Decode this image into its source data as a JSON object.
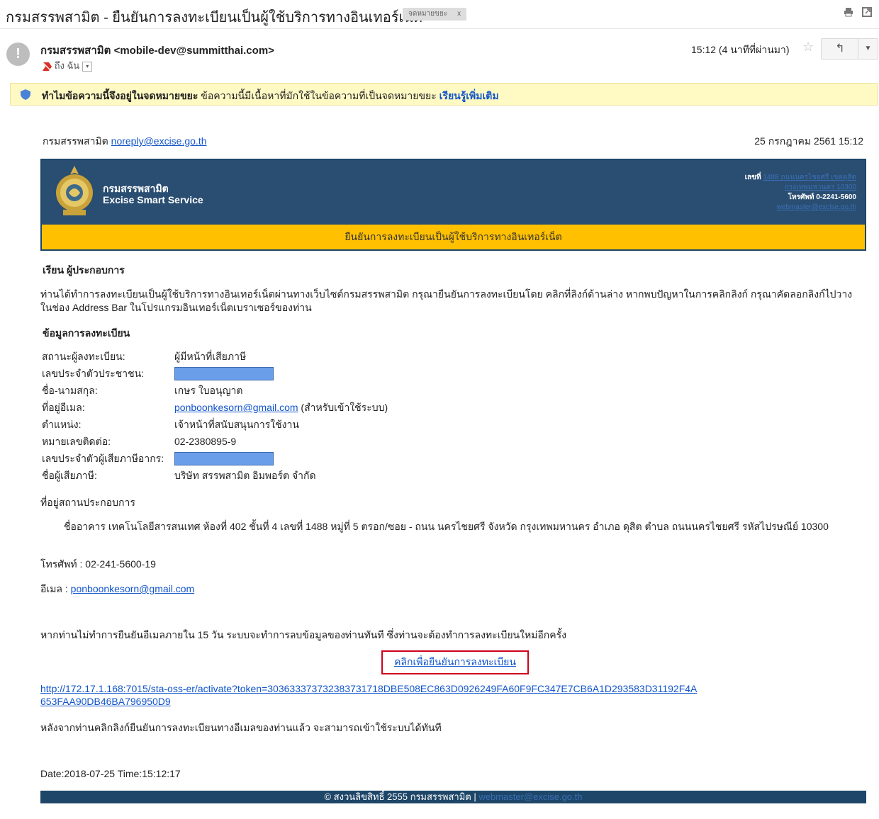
{
  "header": {
    "subject": "กรมสรรพสามิต - ยืนยันการลงทะเบียนเป็นผู้ใช้บริการทางอินเทอร์เน็ต",
    "label": "จดหมายขยะ",
    "label_close": "x"
  },
  "sender": {
    "avatar_glyph": "!",
    "name": "กรมสรรพสามิต",
    "email": "<mobile-dev@summitthai.com>",
    "to": "ถึง ฉัน",
    "timestamp": "15:12 (4 นาทีที่ผ่านมา)"
  },
  "spam_banner": {
    "bold": "ทำไมข้อความนี้จึงอยู่ในจดหมายขยะ",
    "text": "ข้อความนี้มีเนื้อหาที่มักใช้ในข้อความที่เป็นจดหมายขยะ",
    "link": "เรียนรู้เพิ่มเติม"
  },
  "email": {
    "from_name": "กรมสรรพสามิต",
    "from_email": "noreply@excise.go.th",
    "date": "25 กรกฎาคม 2561 15:12",
    "org_th": "กรมสรรพสามิต",
    "org_en": "Excise Smart Service",
    "contact_label": "เลขที่",
    "contact_addr": "1488 ถนนนครไชยศรี เขตดุสิต",
    "contact_addr2": "กรุงเทพมหานคร 10300",
    "contact_phone": "โทรศัพท์ 0-2241-5600",
    "contact_web": "webmaster@excise.go.th",
    "band_title": "ยืนยันการลงทะเบียนเป็นผู้ใช้บริการทางอินเทอร์เน็ต",
    "greeting": "เรียน ผู้ประกอบการ",
    "intro": "ท่านได้ทำการลงทะเบียนเป็นผู้ใช้บริการทางอินเทอร์เน็ตผ่านทางเว็บไซต์กรมสรรพสามิต กรุณายืนยันการลงทะเบียนโดย คลิกที่ลิงก์ด้านล่าง หากพบปัญหาในการคลิกลิงก์ กรุณาคัดลอกลิงก์ไปวางในช่อง Address Bar ในโปรแกรมอินเทอร์เน็ตเบราเซอร์ของท่าน",
    "reg_title": "ข้อมูลการลงทะเบียน",
    "reg": {
      "status_k": "สถานะผู้ลงทะเบียน:",
      "status_v": "ผู้มีหน้าที่เสียภาษี",
      "id_k": "เลขประจำตัวประชาชน:",
      "name_k": "ชื่อ-นามสกุล:",
      "name_v": "เกษร ใบอนุญาต",
      "email_k": "ที่อยู่อีเมล:",
      "email_v": "ponboonkesorn@gmail.com",
      "email_note": "(สำหรับเข้าใช้ระบบ)",
      "pos_k": "ตำแหน่ง:",
      "pos_v": "เจ้าหน้าที่สนับสนุนการใช้งาน",
      "phone_k": "หมายเลขติดต่อ:",
      "phone_v": "02-2380895-9",
      "taxid_k": "เลขประจำตัวผู้เสียภาษีอากร:",
      "taxpayer_k": "ชื่อผู้เสียภาษี:",
      "taxpayer_v": "บริษัท สรรพสามิต อิมพอร์ต จำกัด"
    },
    "addr_heading": "ที่อยู่สถานประกอบการ",
    "addr": "ชื่ออาคาร เทคโนโลยีสารสนเทศ ห้องที่ 402 ชั้นที่ 4 เลขที่ 1488 หมู่ที่ 5 ตรอก/ซอย - ถนน นครไชยศรี จังหวัด กรุงเทพมหานคร อำเภอ ดุสิต ตำบล ถนนนครไชยศรี รหัสไปรษณีย์ 10300",
    "tel": "โทรศัพท์ : 02-241-5600-19",
    "mail_label": "อีเมล :",
    "mail_value": "ponboonkesorn@gmail.com",
    "warn": "หากท่านไม่ทำการยืนยันอีเมลภายใน 15 วัน ระบบจะทำการลบข้อมูลของท่านทันที ซึ่งท่านจะต้องทำการลงทะเบียนใหม่อีกครั้ง",
    "confirm_link": "คลิกเพื่อยืนยันการลงทะเบียน",
    "activate_url": "http://172.17.1.168:7015/sta-oss-er/activate?token=303633373732383731718DBE508EC863D0926249FA60F9FC347E7CB6A1D293583D31192F4A653FAA90DB46BA796950D9",
    "after": "หลังจากท่านคลิกลิงก์ยืนยันการลงทะเบียนทางอีเมลของท่านแล้ว จะสามารถเข้าใช้ระบบได้ทันที",
    "dateline": "Date:2018-07-25 Time:15:12:17",
    "footer_text": "© สงวนลิขสิทธิ์ 2555 กรมสรรพสามิต |",
    "footer_link": "webmaster@excise.go.th"
  },
  "colors": {
    "link": "#1155cc",
    "card_blue": "#2a4e72",
    "band_yellow": "#ffc000",
    "spam_yellow": "#fff9c4",
    "confirm_border": "#d0021b"
  }
}
